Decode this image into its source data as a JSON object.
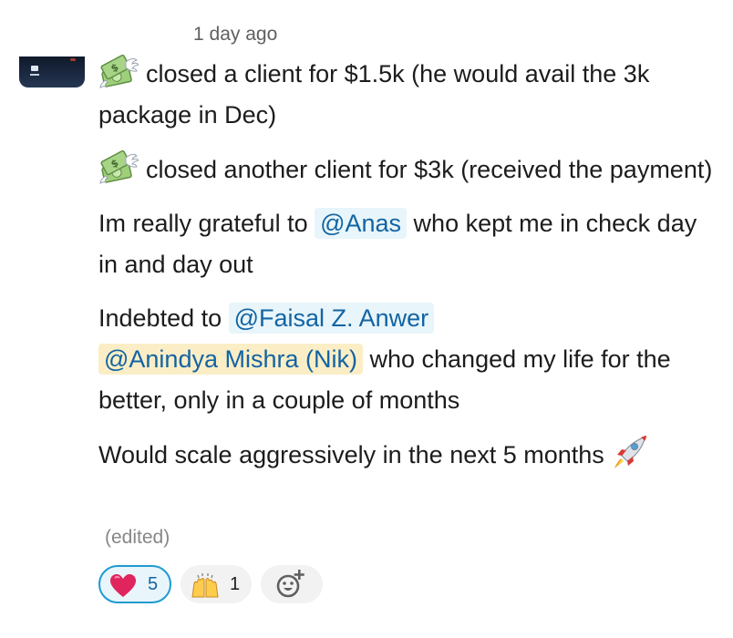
{
  "message": {
    "timestamp": "1 day ago",
    "lines": {
      "p1_text": "closed a client for $1.5k (he would avail the 3k package in Dec)",
      "p2_text": "closed another client for $3k (received the payment)",
      "p3_before": "Im really grateful to ",
      "p3_mention": "@Anas",
      "p3_after": " who kept me in check day in and day out",
      "p4_before": "Indebted to ",
      "p4_mention1": "@Faisal Z. Anwer",
      "p4_mention2": "@Anindya Mishra (Nik)",
      "p4_after": " who changed my life for the better, only in a couple of months",
      "p5_text": "Would scale aggressively in the next 5 months "
    },
    "edited_label": "(edited)",
    "emoji": {
      "money": "money-with-wings-icon",
      "rocket": "rocket-icon"
    }
  },
  "reactions": [
    {
      "icon": "red-heart-icon",
      "count": "5",
      "active": true
    },
    {
      "icon": "raising-hands-icon",
      "count": "1",
      "active": false
    }
  ],
  "add_reaction": {
    "icon": "add-emoji-reaction-icon"
  },
  "colors": {
    "mention_text": "#1264a3",
    "mention_bg": "#e8f5fa",
    "self_mention_bg": "#fbeec6",
    "active_reaction_border": "#1d9bd1"
  }
}
